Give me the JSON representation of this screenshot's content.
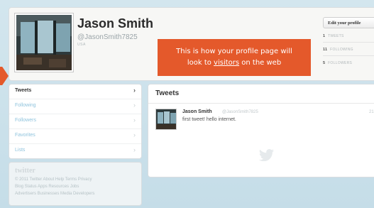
{
  "profile": {
    "name": "Jason Smith",
    "handle": "@JasonSmith7825",
    "location": "USA",
    "edit_button": "Edit your profile",
    "stats": [
      {
        "count": "1",
        "label": "TWEETS"
      },
      {
        "count": "11",
        "label": "FOLLOWING"
      },
      {
        "count": "5",
        "label": "FOLLOWERS"
      }
    ]
  },
  "callout": {
    "line1": "This is how your profile page will",
    "line2_prefix": "look to ",
    "line2_link": "visitors",
    "line2_suffix": " on the web"
  },
  "sidebar": {
    "items": [
      {
        "label": "Tweets",
        "active": true
      },
      {
        "label": "Following",
        "active": false
      },
      {
        "label": "Followers",
        "active": false
      },
      {
        "label": "Favorites",
        "active": false
      },
      {
        "label": "Lists",
        "active": false
      }
    ]
  },
  "footer": {
    "logo": "twitter",
    "line1": "© 2011 Twitter About Help Terms Privacy",
    "line2": "Blog Status Apps Resources Jobs",
    "line3": "Advertisers Businesses Media Developers"
  },
  "tweets": {
    "heading": "Tweets",
    "items": [
      {
        "author": "Jason Smith",
        "handle": "@JasonSmith7825",
        "text": "first tweet! hello internet.",
        "time": "21"
      }
    ]
  },
  "colors": {
    "accent_orange": "#e4592b",
    "link_blue": "#8fc3dd",
    "background": "#c9e0ea"
  },
  "icons": {
    "chevron": "chevron-right-icon",
    "bird": "bird-icon"
  }
}
